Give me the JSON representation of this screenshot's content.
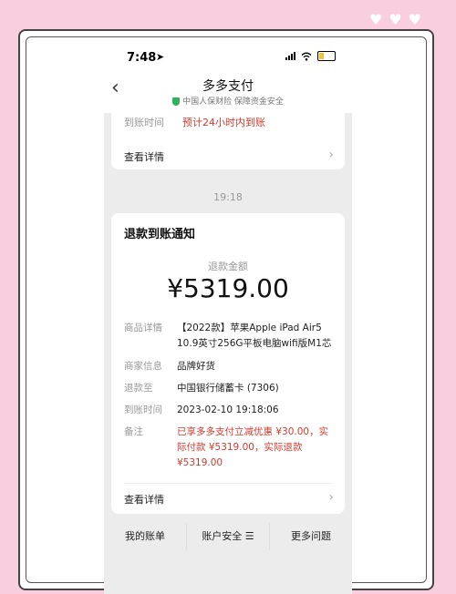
{
  "decor": {
    "hearts": [
      "♥",
      "♥",
      "♥"
    ]
  },
  "status_bar": {
    "time": "7:48",
    "location_arrow": "➤"
  },
  "nav": {
    "back_icon": "‹",
    "title": "多多支付",
    "subtitle": "中国人保财险 保障资金安全"
  },
  "prev_card": {
    "arrival_label": "到账时间",
    "arrival_value": "预计24小时内到账",
    "detail_label": "查看详情"
  },
  "timestamp": "19:18",
  "refund_card": {
    "title": "退款到账通知",
    "amount_label": "退款金额",
    "amount": "¥5319.00",
    "rows": [
      {
        "key": "商品详情",
        "value": "【2022款】苹果Apple iPad Air5 10.9英寸256G平板电脑wifi版M1芯"
      },
      {
        "key": "商家信息",
        "value": "品牌好货"
      },
      {
        "key": "退款至",
        "value": "中国银行储蓄卡 (7306)"
      },
      {
        "key": "到账时间",
        "value": "2023-02-10  19:18:06"
      },
      {
        "key": "备注",
        "value": "已享多多支付立减优惠 ¥30.00，实际付款 ¥5319.00，实际退款 ¥5319.00"
      }
    ],
    "detail_label": "查看详情"
  },
  "bottom_tabs": [
    "我的账单",
    "账户安全 ☰",
    "更多问题"
  ],
  "colors": {
    "accent_red": "#d23a2e",
    "shield_green": "#2db45a",
    "background_pink": "#f9cfe0"
  }
}
